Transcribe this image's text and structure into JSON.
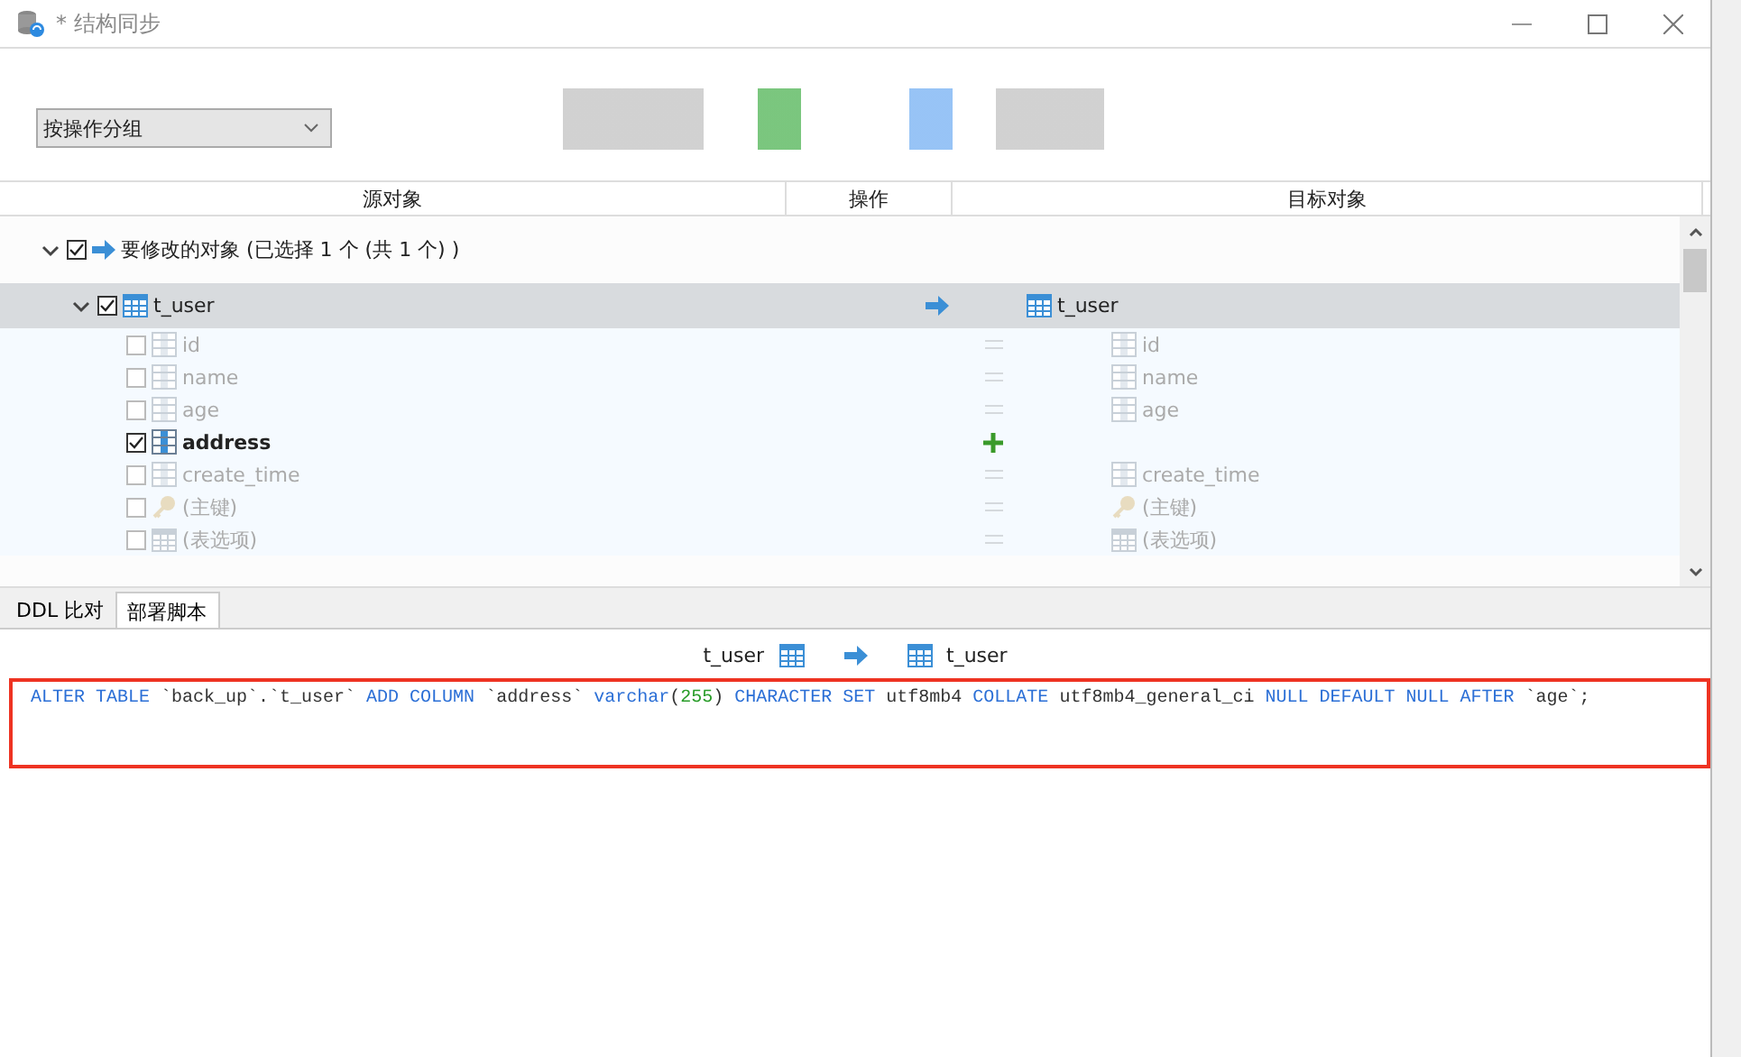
{
  "window": {
    "title": "* 结构同步"
  },
  "group_by": {
    "value": "按操作分组"
  },
  "columns": [
    "源对象",
    "操作",
    "目标对象"
  ],
  "groups": [
    {
      "label": "要修改的对象 (已选择 1 个 (共 1 个) )",
      "checked": true,
      "expanded": true,
      "children": [
        {
          "name": "t_user",
          "kind": "table",
          "checked": true,
          "expanded": true,
          "selected": true,
          "action": {
            "kind": "modify"
          },
          "target": "t_user",
          "children": [
            {
              "name": "id",
              "kind": "column",
              "checked": false,
              "action": {
                "kind": "equal"
              },
              "target": "id"
            },
            {
              "name": "name",
              "kind": "column",
              "checked": false,
              "action": {
                "kind": "equal"
              },
              "target": "name"
            },
            {
              "name": "age",
              "kind": "column",
              "checked": false,
              "action": {
                "kind": "equal"
              },
              "target": "age"
            },
            {
              "name": "address",
              "kind": "column",
              "checked": true,
              "action": {
                "kind": "add"
              }
            },
            {
              "name": "create_time",
              "kind": "column",
              "checked": false,
              "action": {
                "kind": "equal"
              },
              "target": "create_time"
            },
            {
              "name": "(主键)",
              "kind": "key",
              "checked": false,
              "action": {
                "kind": "equal"
              },
              "target": "(主键)"
            },
            {
              "name": "(表选项)",
              "kind": "options",
              "checked": false,
              "action": {
                "kind": "equal"
              },
              "target": "(表选项)"
            }
          ]
        }
      ]
    }
  ],
  "tabs": [
    {
      "label": "DDL 比对",
      "selected": false
    },
    {
      "label": "部署脚本",
      "selected": true
    }
  ],
  "script": {
    "source": "t_user",
    "target": "t_user",
    "code": [
      {
        "text": "ALTER TABLE",
        "kind": "keyword"
      },
      {
        "text": " `back_up`.`t_user` ",
        "kind": "plain"
      },
      {
        "text": "ADD COLUMN",
        "kind": "keyword"
      },
      {
        "text": " `address` ",
        "kind": "plain"
      },
      {
        "text": "varchar",
        "kind": "keyword"
      },
      {
        "text": "(",
        "kind": "plain"
      },
      {
        "text": "255",
        "kind": "number"
      },
      {
        "text": ") ",
        "kind": "plain"
      },
      {
        "text": "CHARACTER SET",
        "kind": "keyword"
      },
      {
        "text": " utf8mb4 ",
        "kind": "plain"
      },
      {
        "text": "COLLATE",
        "kind": "keyword"
      },
      {
        "text": " utf8mb4_general_ci ",
        "kind": "plain"
      },
      {
        "text": "NULL DEFAULT NULL AFTER",
        "kind": "keyword"
      },
      {
        "text": " `age`;",
        "kind": "plain"
      }
    ]
  }
}
